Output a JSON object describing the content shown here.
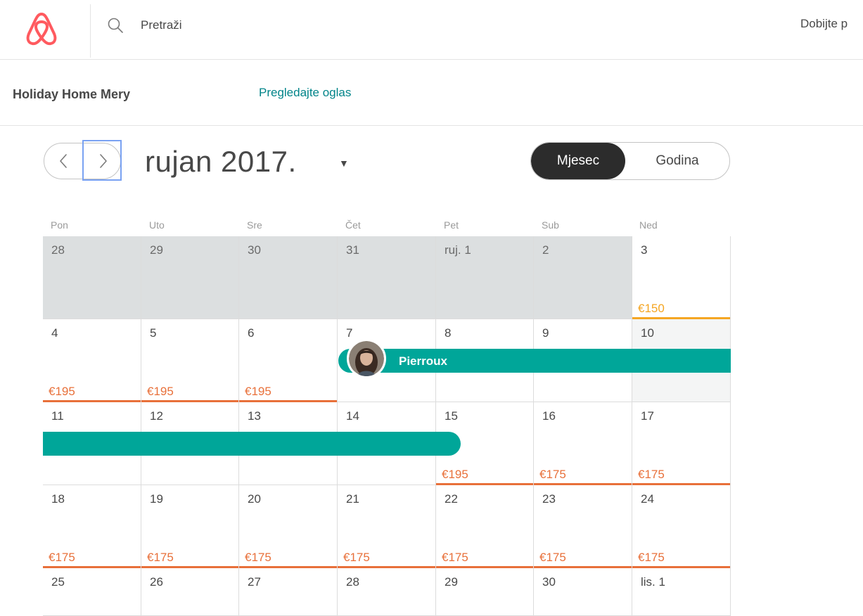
{
  "header": {
    "search_placeholder": "Pretraži",
    "host_link": "Dobijte p"
  },
  "listing": {
    "name": "Holiday Home Mery",
    "preview_link": "Pregledajte oglas"
  },
  "calendar_nav": {
    "month_title": "rujan 2017.",
    "view_month": "Mjesec",
    "view_year": "Godina"
  },
  "weekdays": [
    "Pon",
    "Uto",
    "Sre",
    "Čet",
    "Pet",
    "Sub",
    "Ned"
  ],
  "colors": {
    "accent_teal": "#00a699",
    "price_orange": "#e8703a",
    "price_yellow": "#f5a623",
    "link_teal": "#008489",
    "brand_red": "#ff5a5f"
  },
  "calendar": {
    "weeks": [
      [
        {
          "day": "28",
          "price": "",
          "state": "past"
        },
        {
          "day": "29",
          "price": "",
          "state": "past"
        },
        {
          "day": "30",
          "price": "",
          "state": "past"
        },
        {
          "day": "31",
          "price": "",
          "state": "past"
        },
        {
          "day": "ruj. 1",
          "price": "",
          "state": "past"
        },
        {
          "day": "2",
          "price": "",
          "state": "past"
        },
        {
          "day": "3",
          "price": "€150",
          "state": "available-yellow"
        }
      ],
      [
        {
          "day": "4",
          "price": "€195",
          "state": "available"
        },
        {
          "day": "5",
          "price": "€195",
          "state": "available"
        },
        {
          "day": "6",
          "price": "€195",
          "state": "available"
        },
        {
          "day": "7",
          "price": "",
          "state": "booked"
        },
        {
          "day": "8",
          "price": "",
          "state": "booked"
        },
        {
          "day": "9",
          "price": "",
          "state": "booked"
        },
        {
          "day": "10",
          "price": "",
          "state": "blocked"
        }
      ],
      [
        {
          "day": "11",
          "price": "",
          "state": "booked"
        },
        {
          "day": "12",
          "price": "",
          "state": "booked"
        },
        {
          "day": "13",
          "price": "",
          "state": "booked"
        },
        {
          "day": "14",
          "price": "",
          "state": "booked"
        },
        {
          "day": "15",
          "price": "€195",
          "state": "available"
        },
        {
          "day": "16",
          "price": "€175",
          "state": "available"
        },
        {
          "day": "17",
          "price": "€175",
          "state": "available"
        }
      ],
      [
        {
          "day": "18",
          "price": "€175",
          "state": "available"
        },
        {
          "day": "19",
          "price": "€175",
          "state": "available"
        },
        {
          "day": "20",
          "price": "€175",
          "state": "available"
        },
        {
          "day": "21",
          "price": "€175",
          "state": "available"
        },
        {
          "day": "22",
          "price": "€175",
          "state": "available"
        },
        {
          "day": "23",
          "price": "€175",
          "state": "available"
        },
        {
          "day": "24",
          "price": "€175",
          "state": "available"
        }
      ],
      [
        {
          "day": "25",
          "price": "",
          "state": "available"
        },
        {
          "day": "26",
          "price": "",
          "state": "available"
        },
        {
          "day": "27",
          "price": "",
          "state": "available"
        },
        {
          "day": "28",
          "price": "",
          "state": "available"
        },
        {
          "day": "29",
          "price": "",
          "state": "available"
        },
        {
          "day": "30",
          "price": "",
          "state": "available"
        },
        {
          "day": "lis. 1",
          "price": "",
          "state": "available"
        }
      ]
    ],
    "booking": {
      "guest_name": "Pierroux"
    }
  }
}
